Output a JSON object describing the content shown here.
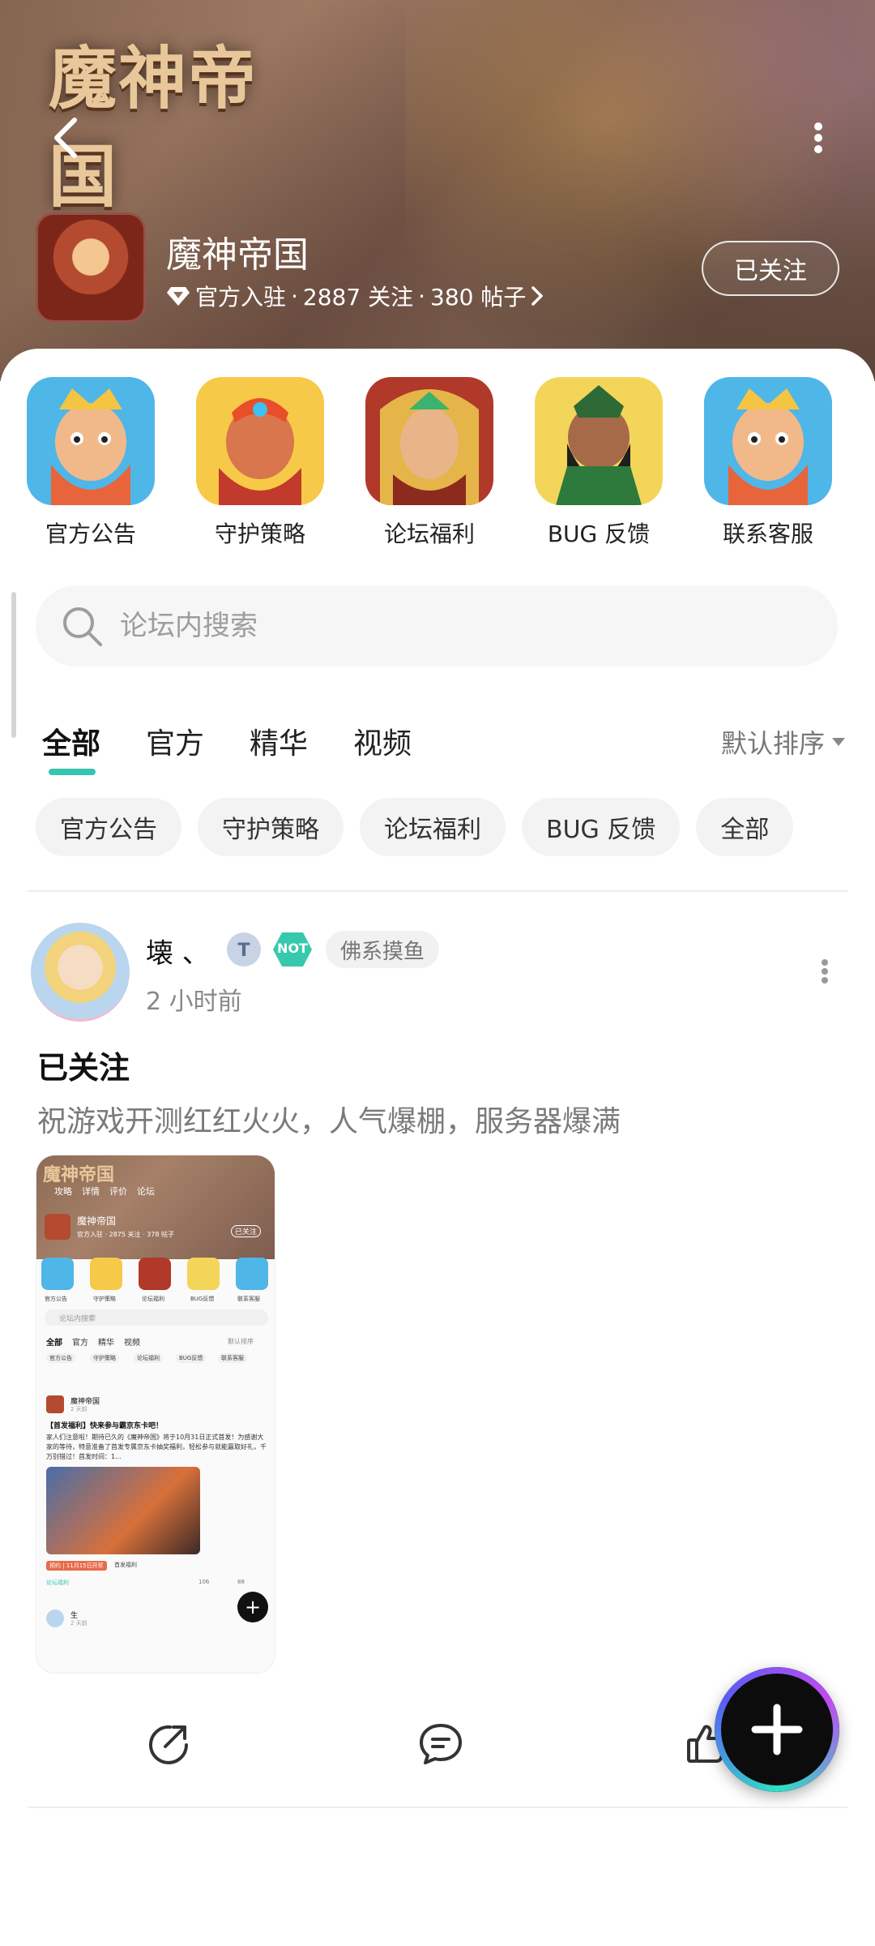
{
  "header": {
    "game_logo_text": "魔神帝国",
    "forum_name": "魔神帝国",
    "official_label": "官方入驻",
    "followers": "2887 关注",
    "posts": "380 帖子",
    "separator": "·",
    "follow_button": "已关注"
  },
  "quick_entries": [
    {
      "label": "官方公告"
    },
    {
      "label": "守护策略"
    },
    {
      "label": "论坛福利"
    },
    {
      "label": "BUG 反馈"
    },
    {
      "label": "联系客服"
    }
  ],
  "search": {
    "placeholder": "论坛内搜索"
  },
  "tabs": [
    {
      "label": "全部",
      "active": true
    },
    {
      "label": "官方"
    },
    {
      "label": "精华"
    },
    {
      "label": "视频"
    }
  ],
  "sort": {
    "label": "默认排序"
  },
  "chips": [
    {
      "label": "官方公告"
    },
    {
      "label": "守护策略"
    },
    {
      "label": "论坛福利"
    },
    {
      "label": "BUG 反馈"
    },
    {
      "label": "全部"
    }
  ],
  "post": {
    "username": "壊 、",
    "badge_text": "NOT",
    "tag": "佛系摸鱼",
    "time": "2 小时前",
    "title": "已关注",
    "body": "祝游戏开测红红火火，人气爆棚，服务器爆满"
  },
  "screenshot_thumbnail": {
    "forum_name": "魔神帝国",
    "meta": "官方入驻 · 2875 关注 · 378 帖子",
    "follow": "已关注",
    "nav": [
      "攻略",
      "详情",
      "评价",
      "论坛"
    ],
    "entries": [
      "官方公告",
      "守护策略",
      "论坛福利",
      "BUG反馈",
      "联系客服"
    ],
    "search": "论坛内搜索",
    "tabs": [
      "全部",
      "官方",
      "精华",
      "视频"
    ],
    "sort": "默认排序",
    "chips": [
      "官方公告",
      "守护策略",
      "论坛福利",
      "BUG反馈",
      "联系客服"
    ],
    "post_author": "魔神帝国",
    "post_time": "2 天前",
    "post_title": "【首发福利】快来参与霸京东卡吧！",
    "post_text": "家人们注意啦！期待已久的《魔神帝国》将于10月31日正式首发！为感谢大家的等待，特意准备了首发专属京东卡抽奖福利，轻松参与就能赢取好礼，千万别错过！首发时间：1...",
    "post_tag": "预约 | 11月15日开奖",
    "post_tag2": "首发福利",
    "post_section": "论坛福利",
    "comments": "106",
    "likes": "88",
    "next_author": "生",
    "next_time": "2 天前"
  },
  "colors": {
    "accent": "#37c4b0",
    "chip_bg": "#f3f3f3",
    "muted": "#888888"
  },
  "icons": [
    "back-icon",
    "more-icon",
    "diamond-icon",
    "chevron-right-icon",
    "search-icon",
    "caret-down-icon",
    "share-icon",
    "comment-icon",
    "like-icon",
    "plus-icon"
  ]
}
